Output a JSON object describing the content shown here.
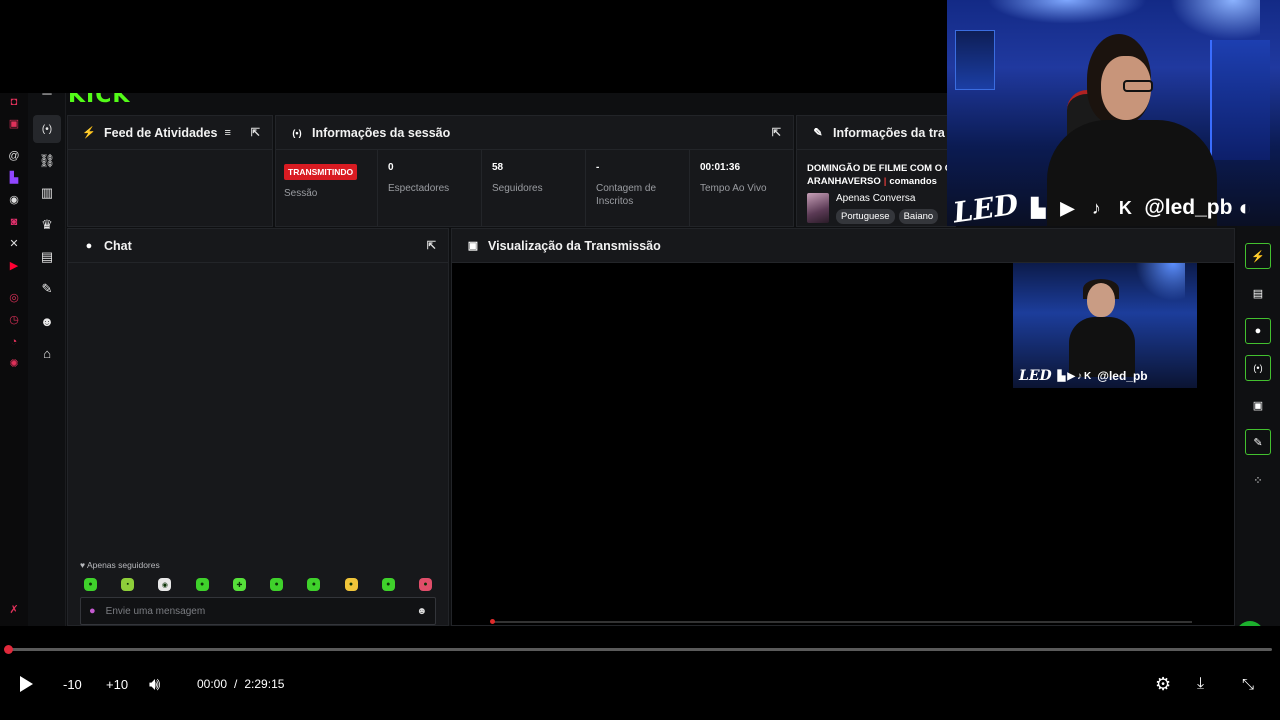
{
  "app": {
    "logo": "KICK"
  },
  "panels": {
    "feed": {
      "title": "Feed de Atividades"
    },
    "session": {
      "title": "Informações da sessão",
      "stats": [
        {
          "value": "TRANSMITINDO",
          "label": "Sessão"
        },
        {
          "value": "0",
          "label": "Espectadores"
        },
        {
          "value": "58",
          "label": "Seguidores"
        },
        {
          "value": "-",
          "label": "Contagem de Inscritos"
        },
        {
          "value": "00:01:36",
          "label": "Tempo Ao Vivo"
        }
      ]
    },
    "stream": {
      "title": "Informações da tra",
      "stream_title": "DOMINGÃO DE FILME COM O C",
      "stream_title_2": "ARANHAVERSO",
      "commands": "comandos",
      "category": "Apenas Conversa",
      "tags": [
        "Portuguese",
        "Baiano"
      ]
    },
    "chat": {
      "title": "Chat",
      "followers_only": "Apenas seguidores",
      "input_placeholder": "Envie uma mensagem"
    },
    "preview": {
      "title": "Visualização da Transmissão",
      "overlay_text": "LED",
      "overlay_handle": "@led_pb"
    }
  },
  "webcam": {
    "overlay_text": "LED",
    "handle": "@led_pb"
  },
  "player": {
    "skip_back": "-10",
    "skip_forward": "+10",
    "current_time": "00:00",
    "duration": "2:29:15",
    "progress_fraction": 0.0
  },
  "colors": {
    "brand": "#53fc18",
    "live_badge": "#d91b22",
    "progress": "#e0293b"
  }
}
